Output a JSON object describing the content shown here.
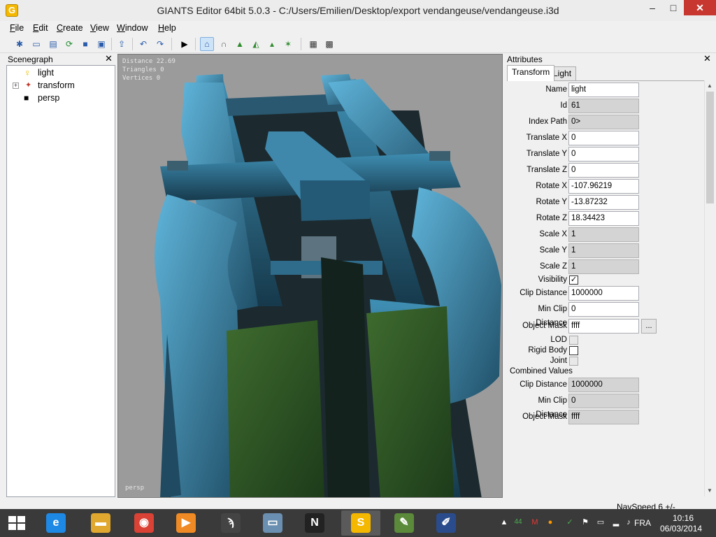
{
  "window": {
    "title": "GIANTS Editor 64bit 5.0.3 - C:/Users/Emilien/Desktop/export vendangeuse/vendangeuse.i3d",
    "app_icon": "G",
    "min": "–",
    "max": "□",
    "close": "✕"
  },
  "menu": [
    {
      "key": "F",
      "rest": "ile"
    },
    {
      "key": "E",
      "rest": "dit"
    },
    {
      "key": "C",
      "rest": "reate"
    },
    {
      "key": "V",
      "rest": "iew"
    },
    {
      "key": "W",
      "rest": "indow"
    },
    {
      "key": "H",
      "rest": "elp"
    }
  ],
  "scenegraph": {
    "title": "Scenegraph",
    "close": "✕",
    "items": [
      {
        "label": "light",
        "icon": "bulb-icon"
      },
      {
        "label": "transform",
        "icon": "transform-icon",
        "expander": "+"
      },
      {
        "label": "persp",
        "icon": "camera-icon"
      }
    ]
  },
  "viewport": {
    "stats": [
      "Distance 22.69",
      "Triangles 0",
      "Vertices 0"
    ],
    "camera": "persp"
  },
  "attributes": {
    "title": "Attributes",
    "close": "✕",
    "tabs": [
      "Transform",
      "Light"
    ],
    "fields": [
      {
        "label": "Name",
        "value": "light",
        "readonly": false
      },
      {
        "label": "Id",
        "value": "61",
        "readonly": true
      },
      {
        "label": "Index Path",
        "value": "0>",
        "readonly": true
      },
      {
        "label": "Translate X",
        "value": "0",
        "readonly": false
      },
      {
        "label": "Translate Y",
        "value": "0",
        "readonly": false
      },
      {
        "label": "Translate Z",
        "value": "0",
        "readonly": false
      },
      {
        "label": "Rotate X",
        "value": "-107.96219",
        "readonly": false
      },
      {
        "label": "Rotate Y",
        "value": "-13.87232",
        "readonly": false
      },
      {
        "label": "Rotate Z",
        "value": "18.34423",
        "readonly": false
      },
      {
        "label": "Scale X",
        "value": "1",
        "readonly": true
      },
      {
        "label": "Scale Y",
        "value": "1",
        "readonly": true
      },
      {
        "label": "Scale Z",
        "value": "1",
        "readonly": true
      }
    ],
    "visibility": {
      "label": "Visibility",
      "mark": "✓"
    },
    "clip_distance": {
      "label": "Clip Distance",
      "value": "1000000"
    },
    "min_clip_distance": {
      "label": "Min Clip Distance",
      "value": "0"
    },
    "object_mask": {
      "label": "Object Mask",
      "value": "ffff",
      "button": "..."
    },
    "lod": {
      "label": "LOD"
    },
    "rigid_body": {
      "label": "Rigid Body"
    },
    "joint": {
      "label": "Joint"
    },
    "combined": {
      "title": "Combined Values",
      "clip_distance": {
        "label": "Clip Distance",
        "value": "1000000"
      },
      "min_clip_distance": {
        "label": "Min Clip Distance",
        "value": "0"
      },
      "object_mask": {
        "label": "Object Mask",
        "value": "ffff"
      }
    }
  },
  "statusbar": {
    "navspeed": "NavSpeed 6 +/-"
  },
  "taskbar": {
    "apps": [
      {
        "name": "ie",
        "glyph": "e",
        "color": "#1e88e5"
      },
      {
        "name": "explorer",
        "glyph": "▬",
        "color": "#e0a82e"
      },
      {
        "name": "chrome",
        "glyph": "◉",
        "color": "#d94235"
      },
      {
        "name": "media",
        "glyph": "▶",
        "color": "#f08a24"
      },
      {
        "name": "app5",
        "glyph": "ϡ",
        "color": "#444"
      },
      {
        "name": "monitor",
        "glyph": "▭",
        "color": "#6b8fb0"
      },
      {
        "name": "notepad-nm",
        "glyph": "N",
        "color": "#222"
      },
      {
        "name": "giants",
        "glyph": "S",
        "color": "#f5b800"
      },
      {
        "name": "app9",
        "glyph": "✎",
        "color": "#5a8a3a"
      },
      {
        "name": "app10",
        "glyph": "✐",
        "color": "#2a4c8c"
      }
    ],
    "tray": {
      "lang": "FRA",
      "time": "10:16",
      "date": "06/03/2014",
      "badge": "44"
    }
  }
}
